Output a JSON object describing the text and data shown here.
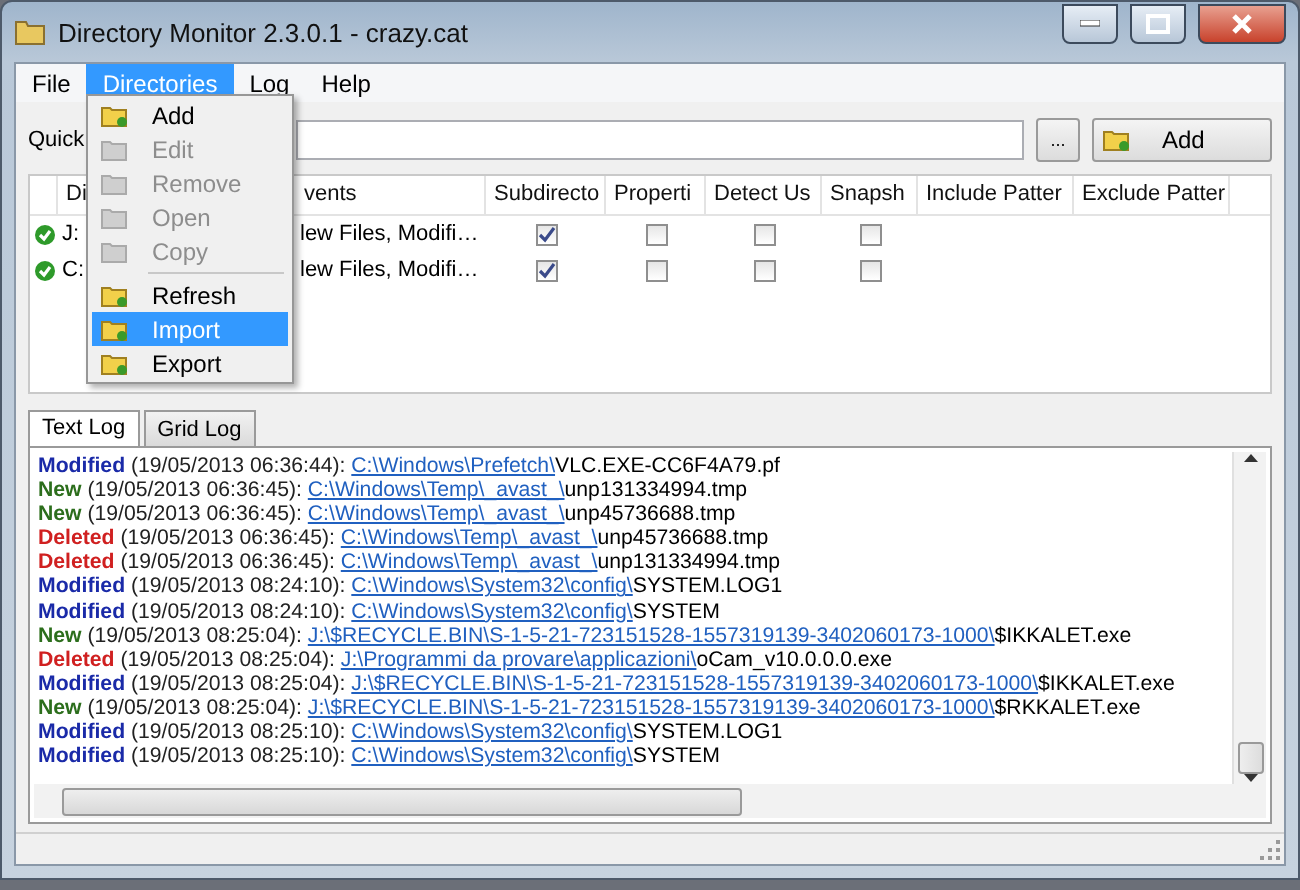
{
  "window": {
    "title": "Directory Monitor 2.3.0.1 - crazy.cat"
  },
  "menu": [
    {
      "label": "File",
      "selected": false
    },
    {
      "label": "Directories",
      "selected": true
    },
    {
      "label": "Log",
      "selected": false
    },
    {
      "label": "Help",
      "selected": false
    }
  ],
  "dropdown": [
    {
      "label": "Add",
      "disabled": false,
      "selected": false
    },
    {
      "label": "Edit",
      "disabled": true,
      "selected": false
    },
    {
      "label": "Remove",
      "disabled": true,
      "selected": false
    },
    {
      "label": "Open",
      "disabled": true,
      "selected": false
    },
    {
      "label": "Copy",
      "disabled": true,
      "selected": false,
      "separator_after": true
    },
    {
      "label": "Refresh",
      "disabled": false,
      "selected": false
    },
    {
      "label": "Import",
      "disabled": false,
      "selected": true
    },
    {
      "label": "Export",
      "disabled": false,
      "selected": false
    }
  ],
  "quick": {
    "label": "Quick",
    "browse_button": "...",
    "add_button": "Add"
  },
  "table": {
    "columns": [
      "Di",
      "vents",
      "Subdirecto",
      "Properti",
      "Detect Us",
      "Snapsh",
      "Include Patter",
      "Exclude Patter"
    ],
    "rows": [
      {
        "dir": "J:",
        "events": "lew Files, Modifi…",
        "subdirectories": true,
        "properties": false,
        "detect_user": false,
        "snapshot": false
      },
      {
        "dir": "C:",
        "events": "lew Files, Modifi…",
        "subdirectories": true,
        "properties": false,
        "detect_user": false,
        "snapshot": false
      }
    ]
  },
  "tabs": [
    {
      "label": "Text Log",
      "selected": true
    },
    {
      "label": "Grid Log",
      "selected": false
    }
  ],
  "log": [
    {
      "kind": "modified",
      "type": "Modified",
      "time": "(19/05/2013 06:36:44):",
      "path": "C:\\Windows\\Prefetch\\",
      "file": "VLC.EXE-CC6F4A79.pf"
    },
    {
      "kind": "new",
      "type": "New",
      "time": "(19/05/2013 06:36:45):",
      "path": "C:\\Windows\\Temp\\_avast_\\",
      "file": "unp131334994.tmp"
    },
    {
      "kind": "new",
      "type": "New",
      "time": "(19/05/2013 06:36:45):",
      "path": "C:\\Windows\\Temp\\_avast_\\",
      "file": "unp45736688.tmp"
    },
    {
      "kind": "deleted",
      "type": "Deleted",
      "time": "(19/05/2013 06:36:45):",
      "path": "C:\\Windows\\Temp\\_avast_\\",
      "file": "unp45736688.tmp"
    },
    {
      "kind": "deleted",
      "type": "Deleted",
      "time": "(19/05/2013 06:36:45):",
      "path": "C:\\Windows\\Temp\\_avast_\\",
      "file": "unp131334994.tmp"
    },
    {
      "kind": "modified",
      "type": "Modified",
      "time": "(19/05/2013 08:24:10):",
      "path": "C:\\Windows\\System32\\config\\",
      "file": "SYSTEM.LOG1"
    },
    {
      "kind": "modified",
      "type": "Modified",
      "time": "(19/05/2013 08:24:10):",
      "path": "C:\\Windows\\System32\\config\\",
      "file": "SYSTEM"
    },
    {
      "kind": "new",
      "type": "New",
      "time": "(19/05/2013 08:25:04):",
      "path": "J:\\$RECYCLE.BIN\\S-1-5-21-723151528-1557319139-3402060173-1000\\",
      "file": "$IKKALET.exe"
    },
    {
      "kind": "deleted",
      "type": "Deleted",
      "time": "(19/05/2013 08:25:04):",
      "path": "J:\\Programmi da provare\\applicazioni\\",
      "file": "oCam_v10.0.0.0.exe"
    },
    {
      "kind": "modified",
      "type": "Modified",
      "time": "(19/05/2013 08:25:04):",
      "path": "J:\\$RECYCLE.BIN\\S-1-5-21-723151528-1557319139-3402060173-1000\\",
      "file": "$IKKALET.exe"
    },
    {
      "kind": "new",
      "type": "New",
      "time": "(19/05/2013 08:25:04):",
      "path": "J:\\$RECYCLE.BIN\\S-1-5-21-723151528-1557319139-3402060173-1000\\",
      "file": "$RKKALET.exe"
    },
    {
      "kind": "modified",
      "type": "Modified",
      "time": "(19/05/2013 08:25:10):",
      "path": "C:\\Windows\\System32\\config\\",
      "file": "SYSTEM.LOG1"
    },
    {
      "kind": "modified",
      "type": "Modified",
      "time": "(19/05/2013 08:25:10):",
      "path": "C:\\Windows\\System32\\config\\",
      "file": "SYSTEM"
    }
  ]
}
